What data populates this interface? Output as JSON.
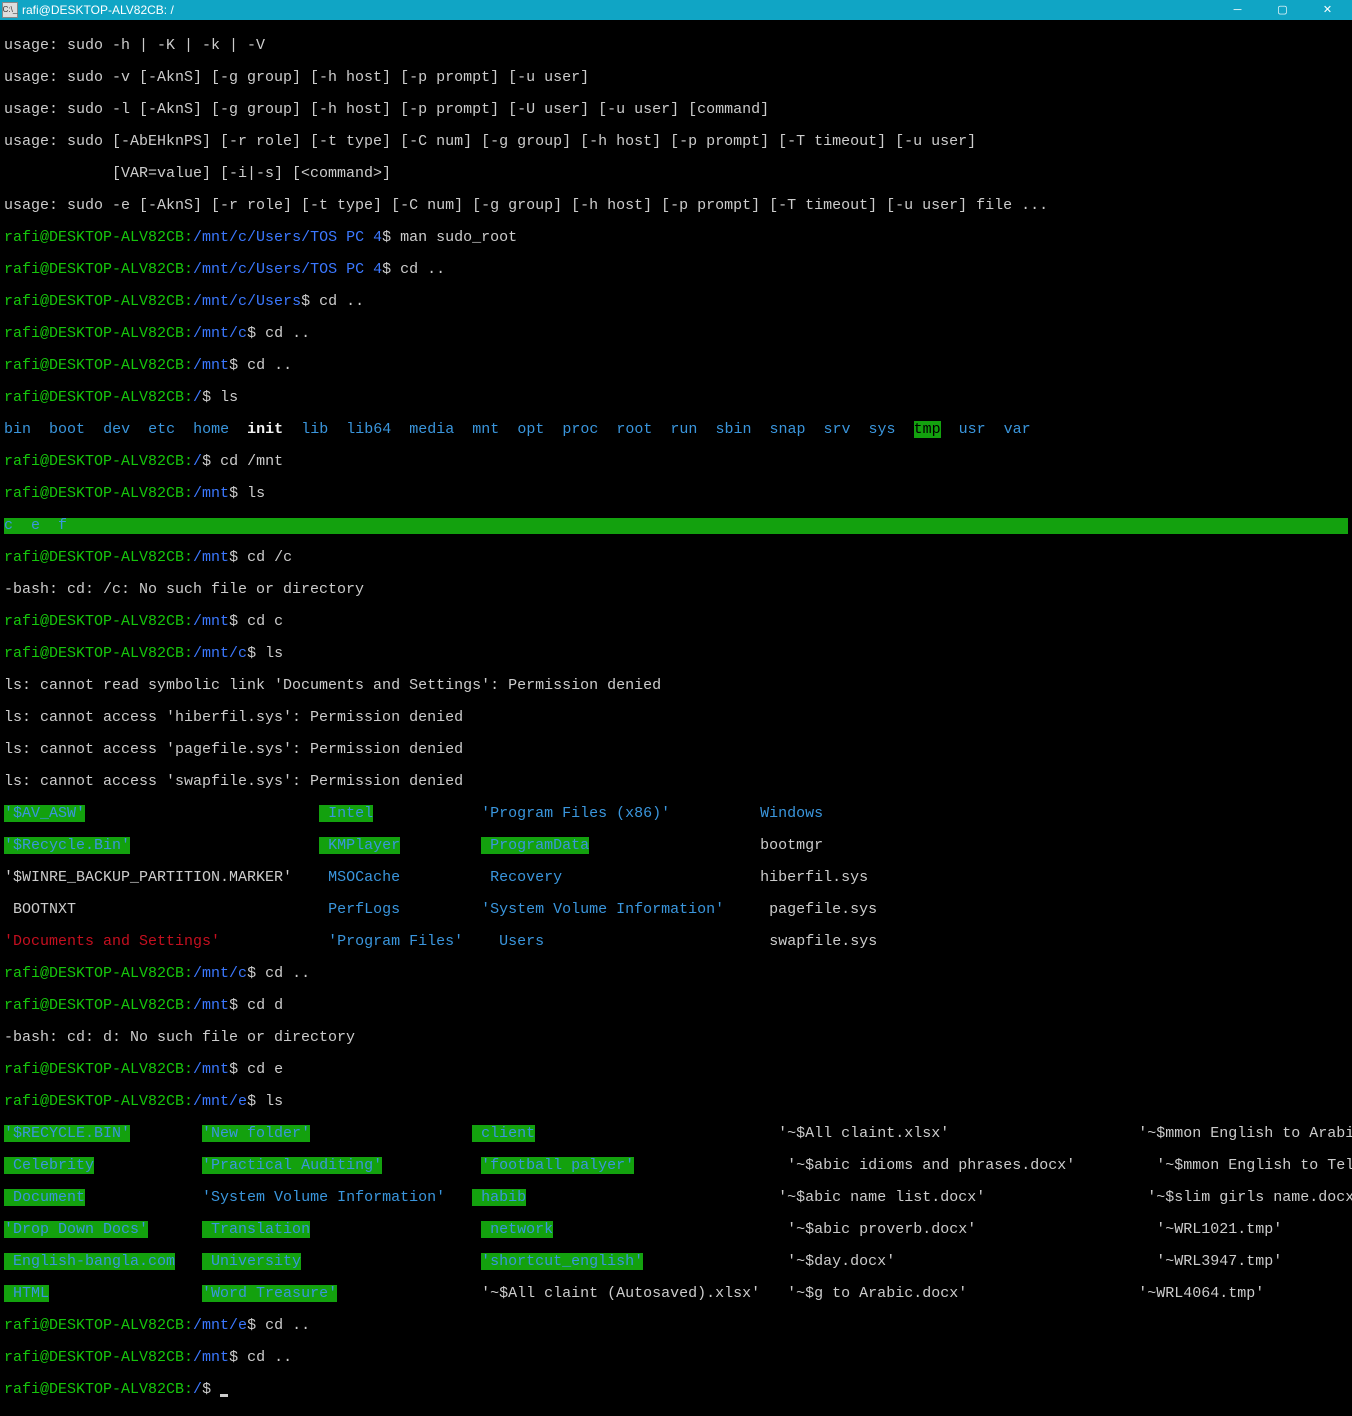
{
  "window": {
    "title": "rafi@DESKTOP-ALV82CB: /",
    "icon_label": "C:\\_"
  },
  "usage": {
    "l1": "usage: sudo -h | -K | -k | -V",
    "l2": "usage: sudo -v [-AknS] [-g group] [-h host] [-p prompt] [-u user]",
    "l3": "usage: sudo -l [-AknS] [-g group] [-h host] [-p prompt] [-U user] [-u user] [command]",
    "l4": "usage: sudo [-AbEHknPS] [-r role] [-t type] [-C num] [-g group] [-h host] [-p prompt] [-T timeout] [-u user]",
    "l5": "            [VAR=value] [-i|-s] [<command>]",
    "l6": "usage: sudo -e [-AknS] [-r role] [-t type] [-C num] [-g group] [-h host] [-p prompt] [-T timeout] [-u user] file ..."
  },
  "prompts": {
    "user_host": "rafi@DESKTOP-ALV82CB",
    "p_tos": "/mnt/c/Users/TOS PC 4",
    "p_users": "/mnt/c/Users",
    "p_mntc": "/mnt/c",
    "p_mnt": "/mnt",
    "p_root": "/",
    "p_mnte": "/mnt/e"
  },
  "cmds": {
    "man": "man sudo_root",
    "cdup": "cd ..",
    "ls": "ls",
    "cdmnt": "cd /mnt",
    "cd_c_slash": "cd /c",
    "cd_c": "cd c",
    "cd_d": "cd d",
    "cd_e": "cd e"
  },
  "root_ls": {
    "bin": "bin",
    "boot": "boot",
    "dev": "dev",
    "etc": "etc",
    "home": "home",
    "init": "init",
    "lib": "lib",
    "lib64": "lib64",
    "media": "media",
    "mnt": "mnt",
    "opt": "opt",
    "proc": "proc",
    "root": "root",
    "run": "run",
    "sbin": "sbin",
    "snap": "snap",
    "srv": "srv",
    "sys": "sys",
    "tmp": "tmp",
    "usr": "usr",
    "var": "var"
  },
  "mnt_ls_line": "c  e  f",
  "errors": {
    "cd_c": "-bash: cd: /c: No such file or directory",
    "ls1": "ls: cannot read symbolic link 'Documents and Settings': Permission denied",
    "ls2": "ls: cannot access 'hiberfil.sys': Permission denied",
    "ls3": "ls: cannot access 'pagefile.sys': Permission denied",
    "ls4": "ls: cannot access 'swapfile.sys': Permission denied",
    "cd_d": "-bash: cd: d: No such file or directory"
  },
  "c_listing": {
    "r1c1": "'$AV_ASW'",
    "r1c2": " Intel",
    "r1c3": "'Program Files (x86)'",
    "r1c4": " Windows",
    "r2c1": "'$Recycle.Bin'",
    "r2c2": " KMPlayer",
    "r2c3": " ProgramData",
    "r2c4": " bootmgr",
    "r3c1": "'$WINRE_BACKUP_PARTITION.MARKER'",
    "r3c2": " MSOCache",
    "r3c3": " Recovery",
    "r3c4": " hiberfil.sys",
    "r4c1": " BOOTNXT",
    "r4c2": " PerfLogs",
    "r4c3": "'System Volume Information'",
    "r4c4": " pagefile.sys",
    "r5c1": "'Documents and Settings'",
    "r5c2": "'Program Files'",
    "r5c3": " Users",
    "r5c4": " swapfile.sys"
  },
  "e_listing": {
    "r1c1": "'$RECYCLE.BIN'",
    "r1c2": "'New folder'",
    "r1c3": " client",
    "r1c4": "'~$All claint.xlsx'",
    "r1c5": "'~$mmon English to Arabic phrase.docx'",
    "r2c1": " Celebrity",
    "r2c2": "'Practical Auditing'",
    "r2c3": "'football palyer'",
    "r2c4": "'~$abic idioms and phrases.docx'",
    "r2c5": "'~$mmon English to Telegu expression.docx'",
    "r3c1": " Document",
    "r3c2": "'System Volume Information'",
    "r3c3": " habib",
    "r3c4": "'~$abic name list.docx'",
    "r3c5": "'~$slim girls name.docx'",
    "r4c1": "'Drop Down Docs'",
    "r4c2": " Translation",
    "r4c3": " network",
    "r4c4": "'~$abic proverb.docx'",
    "r4c5": "'~WRL1021.tmp'",
    "r5c1": " English-bangla.com",
    "r5c2": " University",
    "r5c3": "'shortcut_english'",
    "r5c4": "'~$day.docx'",
    "r5c5": "'~WRL3947.tmp'",
    "r6c1": " HTML",
    "r6c2": "'Word Treasure'",
    "r6c3": "'~$All claint (Autosaved).xlsx'",
    "r6c4": "'~$g to Arabic.docx'",
    "r6c5": "'~WRL4064.tmp'"
  }
}
